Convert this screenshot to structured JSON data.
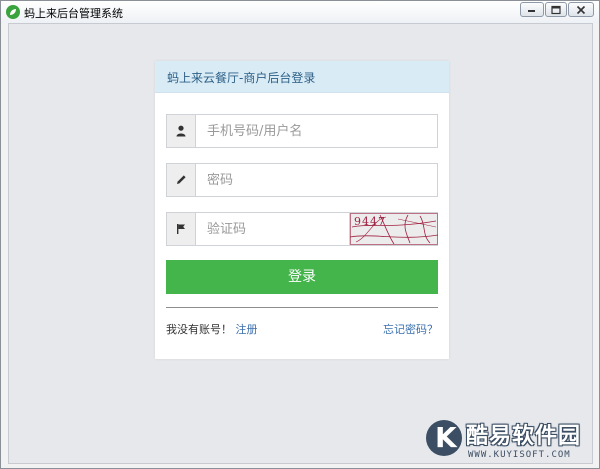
{
  "window": {
    "title": "蚂上来后台管理系统"
  },
  "login": {
    "header": "蚂上来云餐厅-商户后台登录",
    "username_placeholder": "手机号码/用户名",
    "password_placeholder": "密码",
    "captcha_placeholder": "验证码",
    "captcha_text": "9447",
    "login_label": "登录",
    "no_account_text": "我没有账号！",
    "register_label": "注册",
    "forgot_label": "忘记密码？"
  },
  "watermark": {
    "brand": "酷易软件园",
    "url": "WWW.KUYISOFT.COM"
  },
  "colors": {
    "accent_green": "#43b54b",
    "header_bg": "#d9ecf6",
    "link_blue": "#3a6fae"
  },
  "icons": {
    "username": "user-icon",
    "password": "pencil-icon",
    "captcha": "flag-icon"
  }
}
